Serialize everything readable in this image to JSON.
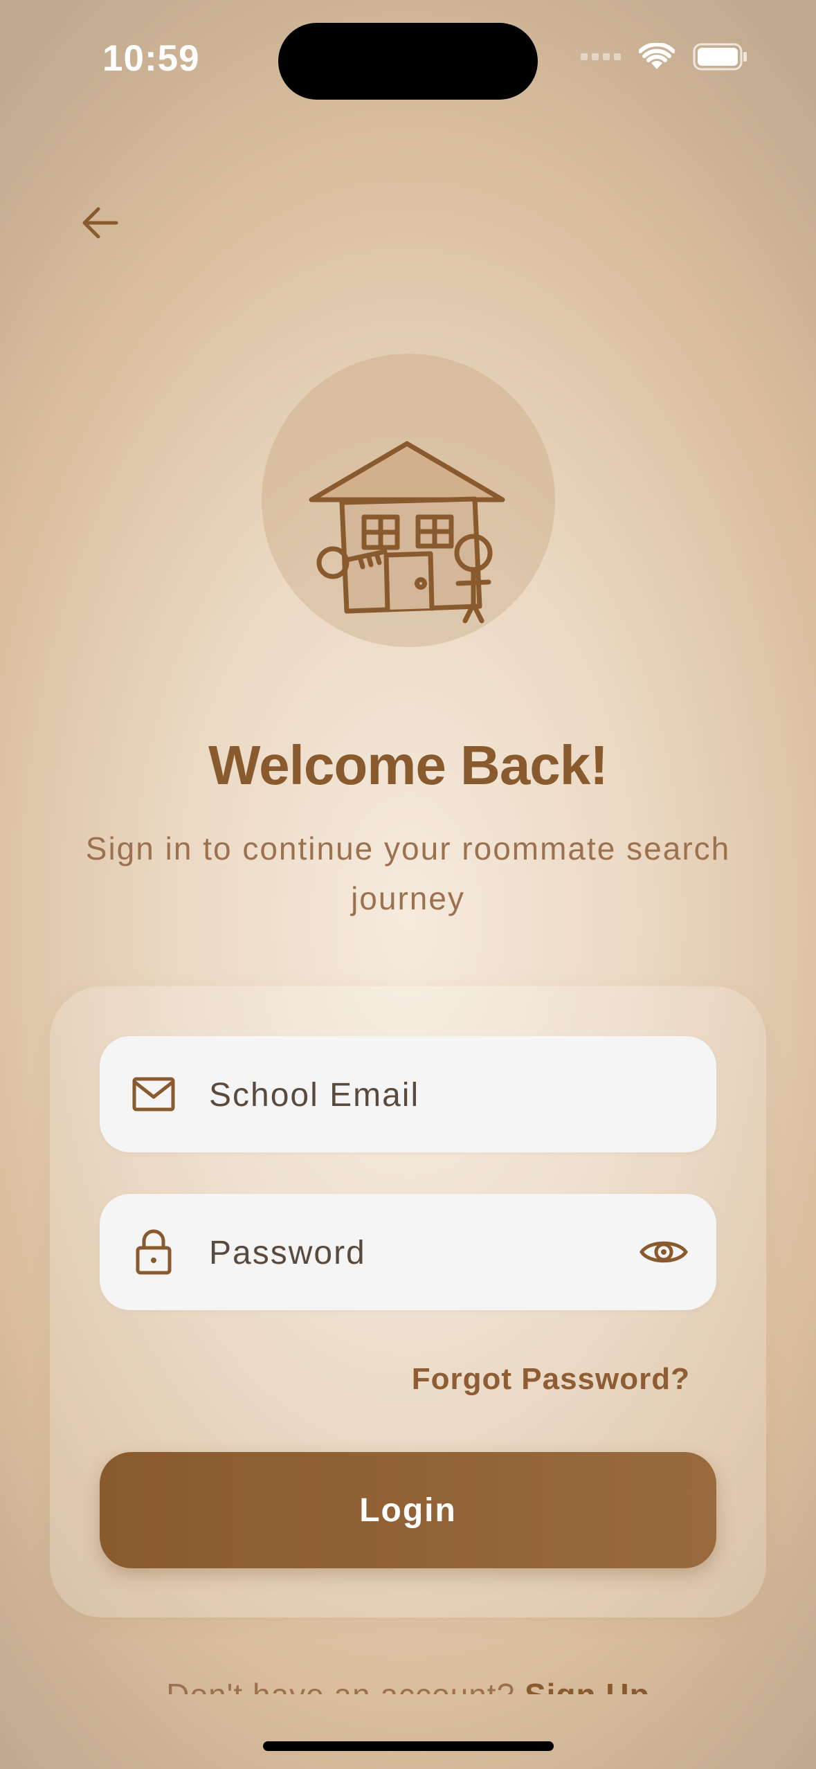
{
  "status_bar": {
    "time": "10:59"
  },
  "header": {
    "back_icon": "arrow-left-icon"
  },
  "logo": {
    "icon": "house-with-key-and-person-illustration"
  },
  "title": "Welcome Back!",
  "subtitle": "Sign in to continue your roommate search journey",
  "form": {
    "email": {
      "placeholder": "School Email",
      "value": "",
      "icon": "envelope-icon"
    },
    "password": {
      "placeholder": "Password",
      "value": "",
      "icon": "lock-icon",
      "toggle_icon": "eye-icon"
    },
    "forgot_label": "Forgot Password?",
    "login_label": "Login"
  },
  "footer": {
    "prompt": "Don't have an account?",
    "signup_label": "Sign Up"
  },
  "colors": {
    "primary": "#8a5a2f",
    "text_secondary": "#9c7150",
    "field_bg": "#f5f5f5"
  }
}
